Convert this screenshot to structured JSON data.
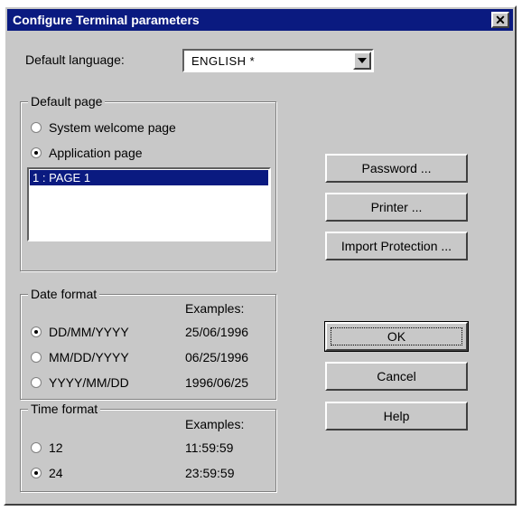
{
  "window": {
    "title": "Configure Terminal parameters",
    "close_glyph": "✕"
  },
  "language": {
    "label": "Default language:",
    "value": "ENGLISH *"
  },
  "default_page": {
    "title": "Default page",
    "options": [
      {
        "label": "System welcome page",
        "selected": false
      },
      {
        "label": "Application page",
        "selected": true
      }
    ],
    "list_selected": "1 : PAGE 1"
  },
  "date_format": {
    "title": "Date format",
    "examples_label": "Examples:",
    "options": [
      {
        "label": "DD/MM/YYYY",
        "example": "25/06/1996",
        "selected": true
      },
      {
        "label": "MM/DD/YYYY",
        "example": "06/25/1996",
        "selected": false
      },
      {
        "label": "YYYY/MM/DD",
        "example": "1996/06/25",
        "selected": false
      }
    ]
  },
  "time_format": {
    "title": "Time format",
    "examples_label": "Examples:",
    "options": [
      {
        "label": "12",
        "example": "11:59:59",
        "selected": false
      },
      {
        "label": "24",
        "example": "23:59:59",
        "selected": true
      }
    ]
  },
  "buttons": {
    "password": "Password ...",
    "printer": "Printer ...",
    "import_protection": "Import Protection ...",
    "ok": "OK",
    "cancel": "Cancel",
    "help": "Help"
  },
  "icons": {
    "close": "close-icon",
    "dropdown": "chevron-down-icon"
  }
}
